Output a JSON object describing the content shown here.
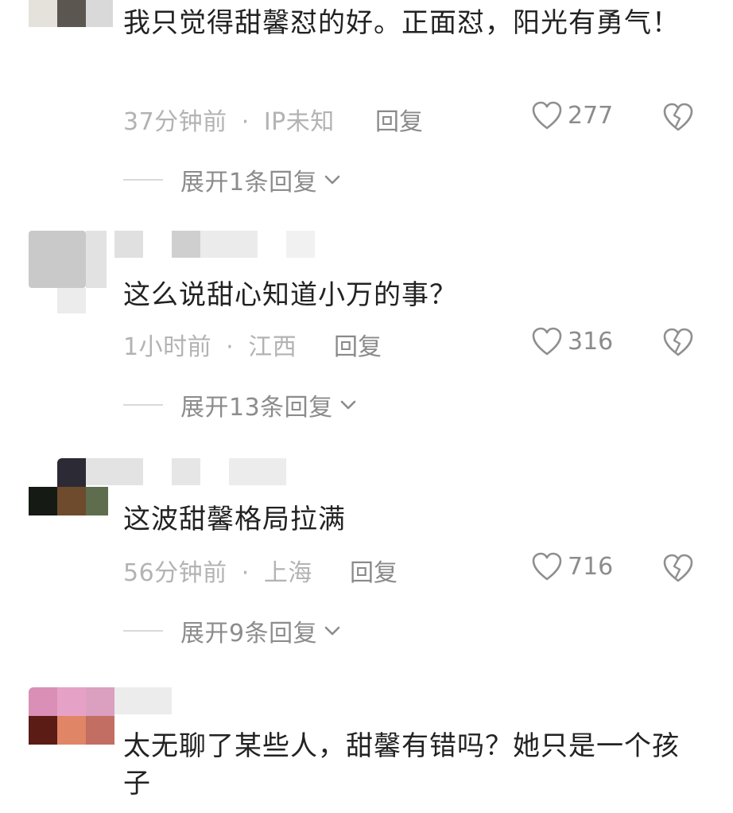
{
  "comments": [
    {
      "text": "我只觉得甜馨怼的好。正面怼，阳光有勇气！",
      "time": "37分钟前",
      "separator": "·",
      "location": "IP未知",
      "reply_label": "回复",
      "likes": "277",
      "expand_label": "展开1条回复"
    },
    {
      "text": "这么说甜心知道小万的事？",
      "time": "1小时前",
      "separator": "·",
      "location": "江西",
      "reply_label": "回复",
      "likes": "316",
      "expand_label": "展开13条回复"
    },
    {
      "text": "这波甜馨格局拉满",
      "time": "56分钟前",
      "separator": "·",
      "location": "上海",
      "reply_label": "回复",
      "likes": "716",
      "expand_label": "展开9条回复"
    },
    {
      "text": "太无聊了某些人，甜馨有错吗？她只是一个孩子"
    }
  ],
  "colors": {
    "text": "#222222",
    "meta": "#b3b3b3",
    "secondary": "#8c8c8c",
    "icon": "#8f8f8f"
  },
  "icons": [
    "heart-icon",
    "broken-heart-icon",
    "chevron-down-icon"
  ]
}
